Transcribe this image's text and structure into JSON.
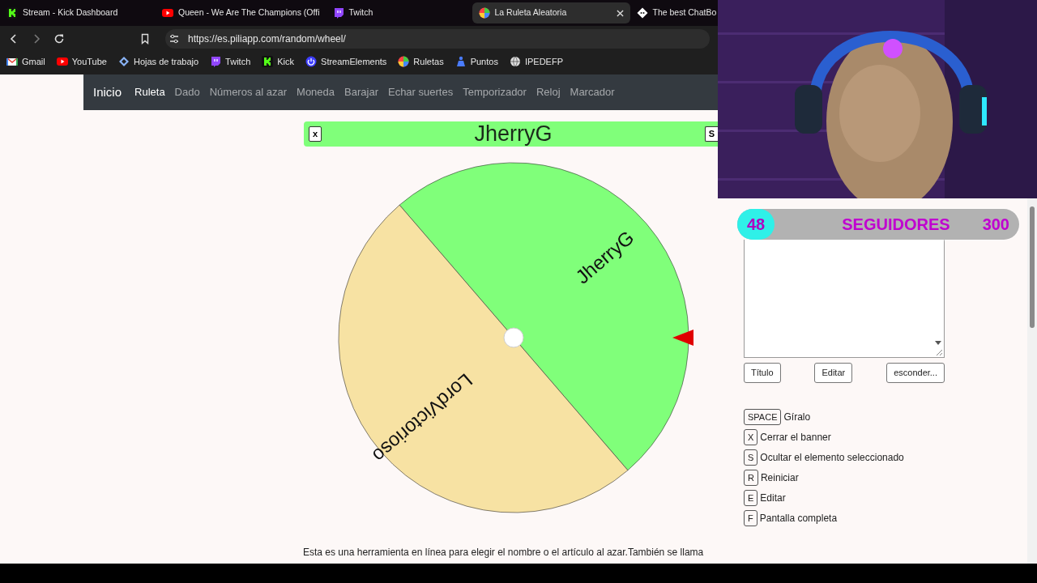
{
  "browser_tabs": [
    {
      "title": "Stream - Kick Dashboard",
      "kind": "kick",
      "selected": false
    },
    {
      "title": "Queen - We Are The Champions (Offi",
      "kind": "youtube",
      "selected": false
    },
    {
      "title": "Twitch",
      "kind": "twitch",
      "selected": false
    },
    {
      "title": "La Ruleta Aleatoria",
      "kind": "wheel",
      "selected": true
    },
    {
      "title": "The best ChatBo",
      "kind": "bot",
      "selected": false
    }
  ],
  "address_bar": {
    "url": "https://es.piliapp.com/random/wheel/"
  },
  "bookmarks": [
    {
      "label": "Gmail",
      "kind": "gmail"
    },
    {
      "label": "YouTube",
      "kind": "youtube"
    },
    {
      "label": "Hojas de trabajo",
      "kind": "diamond"
    },
    {
      "label": "Twitch",
      "kind": "twitch"
    },
    {
      "label": "Kick",
      "kind": "kick"
    },
    {
      "label": "StreamElements",
      "kind": "streamelements"
    },
    {
      "label": "Ruletas",
      "kind": "wheel"
    },
    {
      "label": "Puntos",
      "kind": "puntos"
    },
    {
      "label": "IPEDEFP",
      "kind": "globe"
    }
  ],
  "navbar": {
    "brand": "Inicio",
    "items": [
      {
        "label": "Ruleta",
        "selected": true
      },
      {
        "label": "Dado",
        "selected": false
      },
      {
        "label": "Números al azar",
        "selected": false
      },
      {
        "label": "Moneda",
        "selected": false
      },
      {
        "label": "Barajar",
        "selected": false
      },
      {
        "label": "Echar suertes",
        "selected": false
      },
      {
        "label": "Temporizador",
        "selected": false
      },
      {
        "label": "Reloj",
        "selected": false
      },
      {
        "label": "Marcador",
        "selected": false
      }
    ]
  },
  "banner": {
    "close_key": "x",
    "title": "JherryG",
    "hide_key": "S"
  },
  "wheel": {
    "segments": [
      {
        "label": "JherryG",
        "color": "#80ff7a"
      },
      {
        "label": "LordVictorioso",
        "color": "#f7e2a3"
      }
    ]
  },
  "followers_widget": {
    "count": "48",
    "label": "SEGUIDORES",
    "goal": "300"
  },
  "entries_box": {
    "buttons": [
      "Título",
      "Editar",
      "esconder..."
    ]
  },
  "shortcuts": [
    {
      "key": "SPACE",
      "action": "Gíralo"
    },
    {
      "key": "X",
      "action": "Cerrar el banner"
    },
    {
      "key": "S",
      "action": "Ocultar el elemento seleccionado"
    },
    {
      "key": "R",
      "action": "Reiniciar"
    },
    {
      "key": "E",
      "action": "Editar"
    },
    {
      "key": "F",
      "action": "Pantalla completa"
    }
  ],
  "description": "Esta es una herramienta en línea para elegir el nombre o el artículo al azar.También se llama"
}
